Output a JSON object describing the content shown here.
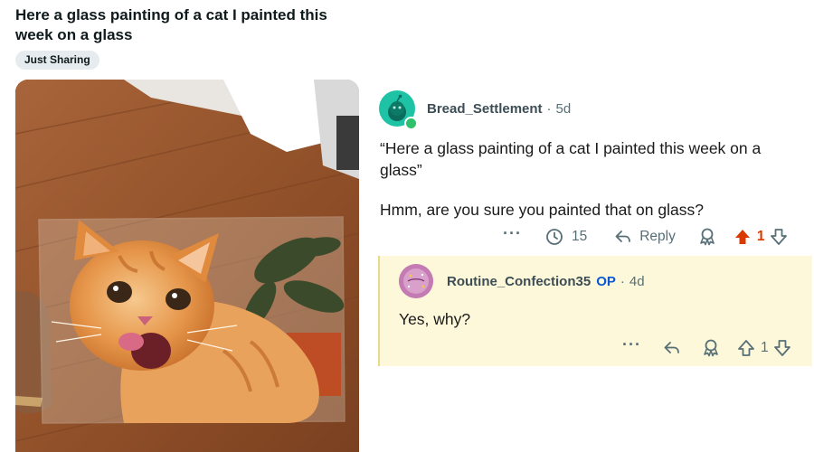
{
  "post": {
    "title": "Here a glass painting of a cat I painted this week on a glass",
    "flair": "Just Sharing"
  },
  "comment": {
    "author": "Bread_Settlement",
    "separator": "·",
    "age": "5d",
    "quote": "“Here a glass painting of a cat I painted this week on a glass”",
    "text": "Hmm, are you sure you painted that on glass?",
    "actions": {
      "more_icon": "more-horizontal-icon",
      "awards_count": "15",
      "reply_label": "Reply",
      "score": "1",
      "upvoted": true,
      "upvote_color": "#d93a00"
    }
  },
  "reply": {
    "author": "Routine_Confection35",
    "op_label": "OP",
    "separator": "·",
    "age": "4d",
    "text": "Yes, why?",
    "background": "#fdf8da",
    "actions": {
      "score": "1"
    }
  }
}
